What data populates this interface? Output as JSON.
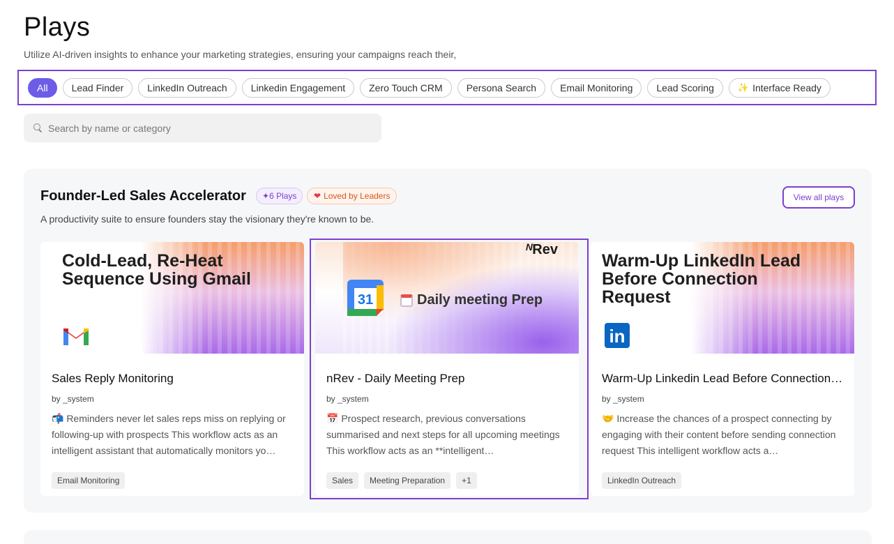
{
  "header": {
    "title": "Plays",
    "subtitle": "Utilize AI-driven insights to enhance your marketing strategies, ensuring your campaigns reach their,"
  },
  "filters": [
    {
      "label": "All",
      "active": true
    },
    {
      "label": "Lead Finder"
    },
    {
      "label": "LinkedIn Outreach"
    },
    {
      "label": "Linkedin Engagement"
    },
    {
      "label": "Zero Touch CRM"
    },
    {
      "label": "Persona Search"
    },
    {
      "label": "Email Monitoring"
    },
    {
      "label": "Lead Scoring"
    },
    {
      "label": "Interface Ready",
      "icon": "sparkles-icon"
    }
  ],
  "search": {
    "placeholder": "Search by name or category",
    "value": ""
  },
  "section": {
    "title": "Founder-Led Sales Accelerator",
    "plays_badge": "6 Plays",
    "loved_badge": "Loved by Leaders",
    "view_all": "View all plays",
    "description": "A productivity suite to ensure founders stay the visionary they're known to be."
  },
  "cards": [
    {
      "thumb_heading_line1": "Cold-Lead, Re-Heat",
      "thumb_heading_line2": "Sequence Using Gmail",
      "title": "Sales Reply Monitoring",
      "author": "by _system",
      "description": "📬 Reminders never let sales reps miss on replying or following-up with prospects This workflow acts as an intelligent assistant that automatically monitors yo…",
      "tags": [
        "Email Monitoring"
      ]
    },
    {
      "thumb_text": "Daily meeting Prep",
      "thumb_brand": "Rev",
      "calendar_day": "31",
      "title": "nRev - Daily Meeting Prep",
      "author": "by _system",
      "description": "📅 Prospect research, previous conversations summarised and next steps for all upcoming meetings This workflow acts as an **intelligent…",
      "tags": [
        "Sales",
        "Meeting Preparation",
        "+1"
      ]
    },
    {
      "thumb_heading_line1": "Warm-Up LinkedIn Lead",
      "thumb_heading_line2": "Before Connection",
      "thumb_heading_line3": "Request",
      "logo_text": "in",
      "title": "Warm-Up Linkedin Lead Before Connection Request",
      "author": "by _system",
      "description": "🤝 Increase the chances of a prospect connecting by engaging with their content before sending connection request This intelligent workflow acts a…",
      "tags": [
        "LinkedIn Outreach"
      ]
    }
  ],
  "colors": {
    "accent": "#7b3fd0",
    "active_chip": "#6d5ce8",
    "loved": "#d4561c"
  }
}
